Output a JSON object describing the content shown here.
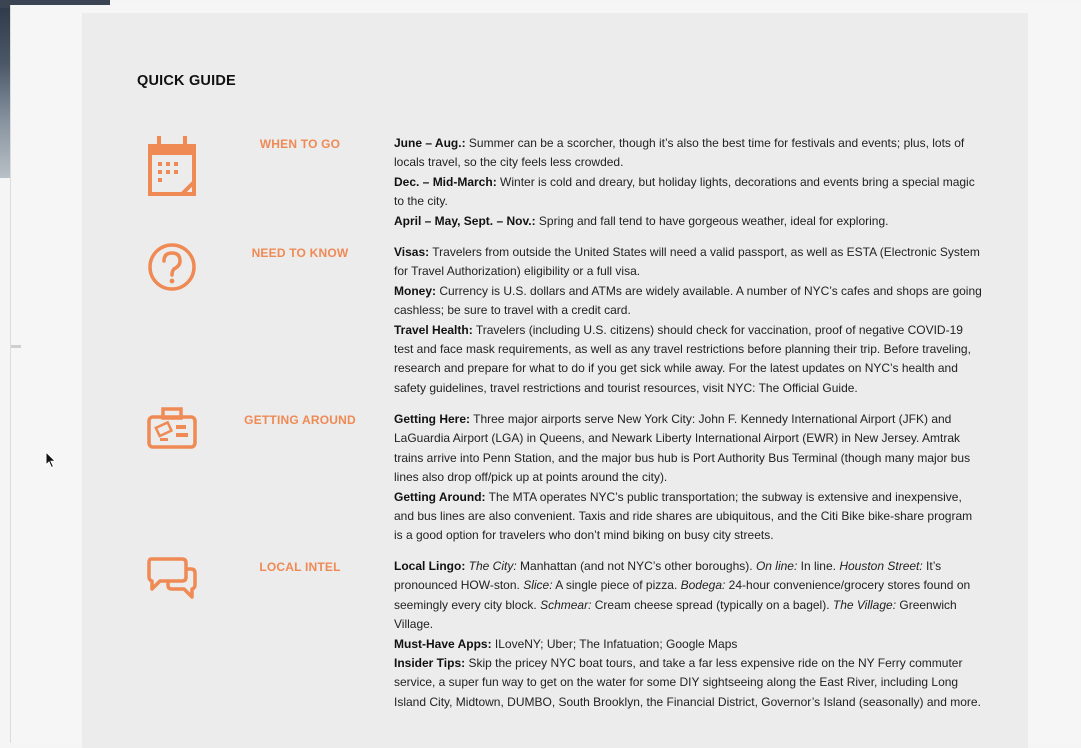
{
  "title": "QUICK GUIDE",
  "accent_color": "#ef8a55",
  "sections": [
    {
      "label": "WHEN TO GO",
      "icon": "calendar-icon",
      "paragraphs": [
        {
          "runs": [
            {
              "t": "June – Aug.:",
              "s": "b"
            },
            {
              "t": " Summer can be a scorcher, though it’s also the best time for festivals and events; plus, lots of locals travel, so the city feels less crowded.",
              "s": ""
            }
          ]
        },
        {
          "runs": [
            {
              "t": "Dec. – Mid-March:",
              "s": "b"
            },
            {
              "t": " Winter is cold and dreary, but holiday lights, decorations and events bring a special magic to the city.",
              "s": ""
            }
          ]
        },
        {
          "runs": [
            {
              "t": "April – May, Sept. – Nov.:",
              "s": "b"
            },
            {
              "t": " Spring and fall tend to have gorgeous weather, ideal for exploring.",
              "s": ""
            }
          ]
        }
      ]
    },
    {
      "label": "NEED TO KNOW",
      "icon": "question-circle-icon",
      "paragraphs": [
        {
          "runs": [
            {
              "t": "Visas:",
              "s": "b"
            },
            {
              "t": " Travelers from outside the United States will need a valid passport, as well as ESTA (Electronic System for Travel Authorization) eligibility or a full visa.",
              "s": ""
            }
          ]
        },
        {
          "runs": [
            {
              "t": "Money:",
              "s": "b"
            },
            {
              "t": " Currency is U.S. dollars and ATMs are widely available. A number of NYC’s cafes and shops are going cashless; be sure to travel with a credit card.",
              "s": ""
            }
          ]
        },
        {
          "runs": [
            {
              "t": "Travel Health:",
              "s": "b"
            },
            {
              "t": " Travelers (including U.S. citizens) should check for vaccination, proof of negative COVID-19 test and face mask requirements, as well as any travel restrictions before planning their trip. Before traveling, research and prepare for what to do if you get sick while away. For the latest updates on NYC’s health and safety guidelines, travel restrictions and tourist resources, visit NYC: The Official Guide.",
              "s": ""
            }
          ]
        }
      ]
    },
    {
      "label": "GETTING AROUND",
      "icon": "suitcase-icon",
      "paragraphs": [
        {
          "runs": [
            {
              "t": "Getting Here:",
              "s": "b"
            },
            {
              "t": " Three major airports serve New York City: John F. Kennedy International Airport (JFK) and LaGuardia Airport (LGA) in Queens, and Newark Liberty International Airport (EWR) in New Jersey. Amtrak trains arrive into Penn Station, and the major bus hub is Port Authority Bus Terminal (though many major bus lines also drop off/pick up at points around the city).",
              "s": ""
            }
          ]
        },
        {
          "runs": [
            {
              "t": "Getting Around:",
              "s": "b"
            },
            {
              "t": " The MTA operates NYC’s public transportation; the subway is extensive and inexpensive, and bus lines are also convenient. Taxis and ride shares are ubiquitous, and the Citi Bike bike-share program is a good option for travelers who don’t mind biking on busy city streets.",
              "s": ""
            }
          ]
        }
      ]
    },
    {
      "label": "LOCAL INTEL",
      "icon": "chat-bubbles-icon",
      "paragraphs": [
        {
          "runs": [
            {
              "t": "Local Lingo:",
              "s": "b"
            },
            {
              "t": " ",
              "s": ""
            },
            {
              "t": "The City:",
              "s": "i"
            },
            {
              "t": " Manhattan (and not NYC’s other boroughs). ",
              "s": ""
            },
            {
              "t": "On line:",
              "s": "i"
            },
            {
              "t": " In line. ",
              "s": ""
            },
            {
              "t": "Houston Street:",
              "s": "i"
            },
            {
              "t": " It’s pronounced HOW-ston. ",
              "s": ""
            },
            {
              "t": "Slice:",
              "s": "i"
            },
            {
              "t": " A single piece of pizza. ",
              "s": ""
            },
            {
              "t": "Bodega:",
              "s": "i"
            },
            {
              "t": " 24-hour convenience/grocery stores found on seemingly every city block. ",
              "s": ""
            },
            {
              "t": "Schmear:",
              "s": "i"
            },
            {
              "t": " Cream cheese spread (typically on a bagel). ",
              "s": ""
            },
            {
              "t": "The Village:",
              "s": "i"
            },
            {
              "t": " Greenwich Village.",
              "s": ""
            }
          ]
        },
        {
          "runs": [
            {
              "t": "Must-Have Apps:",
              "s": "b"
            },
            {
              "t": " ILoveNY; Uber; The Infatuation; Google Maps",
              "s": ""
            }
          ]
        },
        {
          "runs": [
            {
              "t": "Insider Tips:",
              "s": "b"
            },
            {
              "t": " Skip the pricey NYC boat tours, and take a far less expensive ride on the NY Ferry commuter service, a super fun way to get on the water for some DIY sightseeing along the East River, including Long Island City, Midtown, DUMBO, South Brooklyn, the Financial District, Governor’s Island (seasonally) and more.",
              "s": ""
            }
          ]
        }
      ]
    }
  ]
}
